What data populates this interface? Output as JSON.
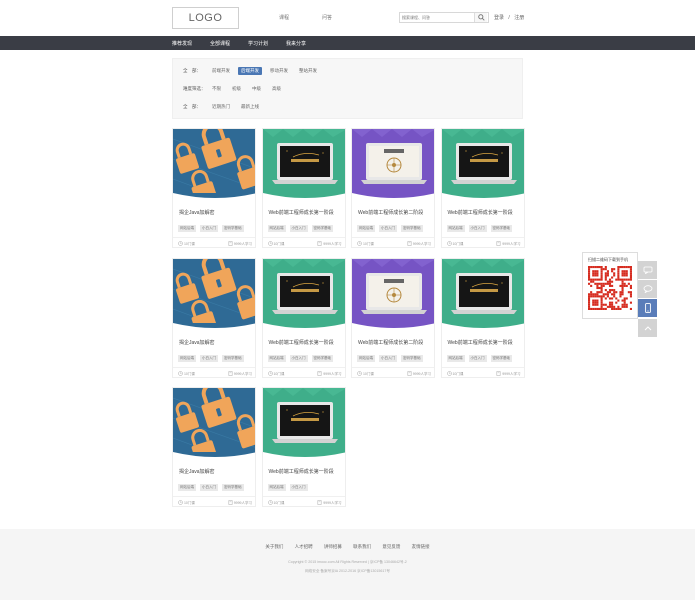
{
  "header": {
    "logo": "LOGO",
    "nav": [
      "课程",
      "问答"
    ],
    "search_placeholder": "搜索课程、问答",
    "login": "登录",
    "separator": "/",
    "register": "注册"
  },
  "main_nav": [
    "推荐发现",
    "全部课程",
    "学习计划",
    "我来分享"
  ],
  "filters": {
    "row1": {
      "label": "全　部：",
      "options": [
        "前端开发",
        "后端开发",
        "移动开发",
        "整站开发"
      ],
      "active_index": 1
    },
    "row2": {
      "label": "难度筛选：",
      "options": [
        "不限",
        "初级",
        "中级",
        "高级"
      ]
    },
    "row3": {
      "label": "全　部：",
      "options": [
        "近期热门",
        "最新上线"
      ]
    }
  },
  "courses": [
    {
      "title": "揭企Java加解密",
      "tags": [
        "网站后端",
        "小白入门",
        "密码学基础"
      ],
      "lessons": "10门课",
      "students": "9999人学习",
      "thumb": "locks"
    },
    {
      "title": "Web前端工程师成长第一阶段",
      "tags": [
        "网站后端",
        "小白入门",
        "密码学基础"
      ],
      "lessons": "10门课",
      "students": "9999人学习",
      "thumb": "green"
    },
    {
      "title": "Web前端工程师成长第二阶段",
      "tags": [
        "网站后端",
        "小白入门",
        "密码学基础"
      ],
      "lessons": "10门课",
      "students": "9999人学习",
      "thumb": "purple"
    },
    {
      "title": "Web前端工程师成长第一阶段",
      "tags": [
        "网站后端",
        "小白入门",
        "密码学基础"
      ],
      "lessons": "10门课",
      "students": "9999人学习",
      "thumb": "green"
    },
    {
      "title": "揭企Java加解密",
      "tags": [
        "网站后端",
        "小白入门",
        "密码学基础"
      ],
      "lessons": "10门课",
      "students": "9999人学习",
      "thumb": "locks"
    },
    {
      "title": "Web前端工程师成长第一阶段",
      "tags": [
        "网站后端",
        "小白入门",
        "密码学基础"
      ],
      "lessons": "10门课",
      "students": "9999人学习",
      "thumb": "green"
    },
    {
      "title": "Web前端工程师成长第二阶段",
      "tags": [
        "网站后端",
        "小白入门",
        "密码学基础"
      ],
      "lessons": "10门课",
      "students": "9999人学习",
      "thumb": "purple"
    },
    {
      "title": "Web前端工程师成长第一阶段",
      "tags": [
        "网站后端",
        "小白入门",
        "密码学基础"
      ],
      "lessons": "10门课",
      "students": "9999人学习",
      "thumb": "green"
    },
    {
      "title": "揭企Java加解密",
      "tags": [
        "网站后端",
        "小白入门",
        "密码学基础"
      ],
      "lessons": "10门课",
      "students": "9999人学习",
      "thumb": "locks"
    },
    {
      "title": "Web前端工程师成长第一阶段",
      "tags": [
        "网站后端",
        "小白入门"
      ],
      "lessons": "10门课",
      "students": "9999人学习",
      "thumb": "green"
    }
  ],
  "sidebar": {
    "qr_text": "扫描二维码下载到手机",
    "buttons": [
      "message-icon",
      "chat-icon",
      "phone-icon",
      "back-to-top-icon"
    ]
  },
  "footer": {
    "links": [
      "关于我们",
      "人才招聘",
      "讲师招募",
      "联系我们",
      "意见反馈",
      "友情链接"
    ],
    "copyright": "Copyright © 2015 imooc.com All Rights Reserved | 京ICP备 13046642号-2",
    "icp": "网络安全 备案号京IA 2012-2016 京ICP备13015617号"
  },
  "colors": {
    "nav_bg": "#3a3d45",
    "active_filter": "#4a77b4",
    "thumb_green": "#3fae8a",
    "thumb_purple": "#7654c4",
    "thumb_blue": "#2f6a95",
    "thumb_orange": "#f0a55a"
  }
}
